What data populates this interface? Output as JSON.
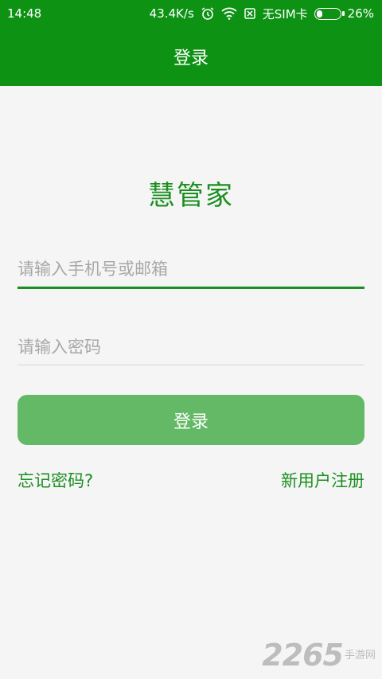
{
  "status_bar": {
    "time": "14:48",
    "speed": "43.4K/s",
    "sim": "无SIM卡",
    "battery": "26%",
    "battery_level": 0.26,
    "icons": [
      "alarm-icon",
      "wifi-icon",
      "no-sim-icon",
      "battery-icon"
    ]
  },
  "header": {
    "title": "登录"
  },
  "app": {
    "name": "慧管家"
  },
  "form": {
    "username_placeholder": "请输入手机号或邮箱",
    "username_value": "",
    "password_placeholder": "请输入密码",
    "password_value": "",
    "login_label": "登录"
  },
  "links": {
    "forgot": "忘记密码?",
    "register": "新用户注册"
  },
  "watermark": {
    "number": "2265",
    "text": "手游网"
  },
  "colors": {
    "primary": "#0d9214",
    "accent_text": "#1b8f20",
    "button": "#63b965",
    "background": "#f5f5f5"
  }
}
